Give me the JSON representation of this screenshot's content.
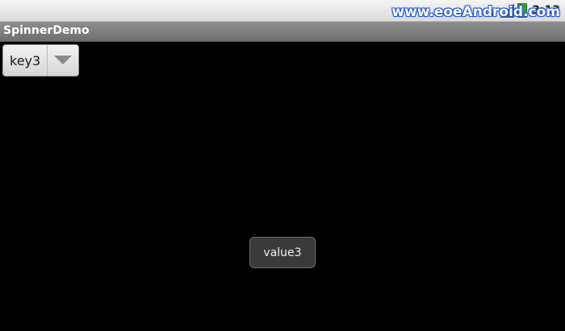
{
  "status_bar": {
    "network_icon": "3g-signal-icon",
    "signal_icon": "cell-signal-icon",
    "battery_icon": "battery-icon",
    "time": "3:13",
    "watermark": "www.eoeAndroid.com"
  },
  "app": {
    "title": "SpinnerDemo"
  },
  "spinner": {
    "selected": "key3",
    "arrow_icon": "dropdown-arrow-icon"
  },
  "toast": {
    "text": "value3"
  },
  "colors": {
    "background": "#000000",
    "title_bar": "#7f7f7f",
    "status_bar": "#e8e8e8",
    "watermark": "#1c4fd0",
    "battery": "#3a9b3a"
  }
}
